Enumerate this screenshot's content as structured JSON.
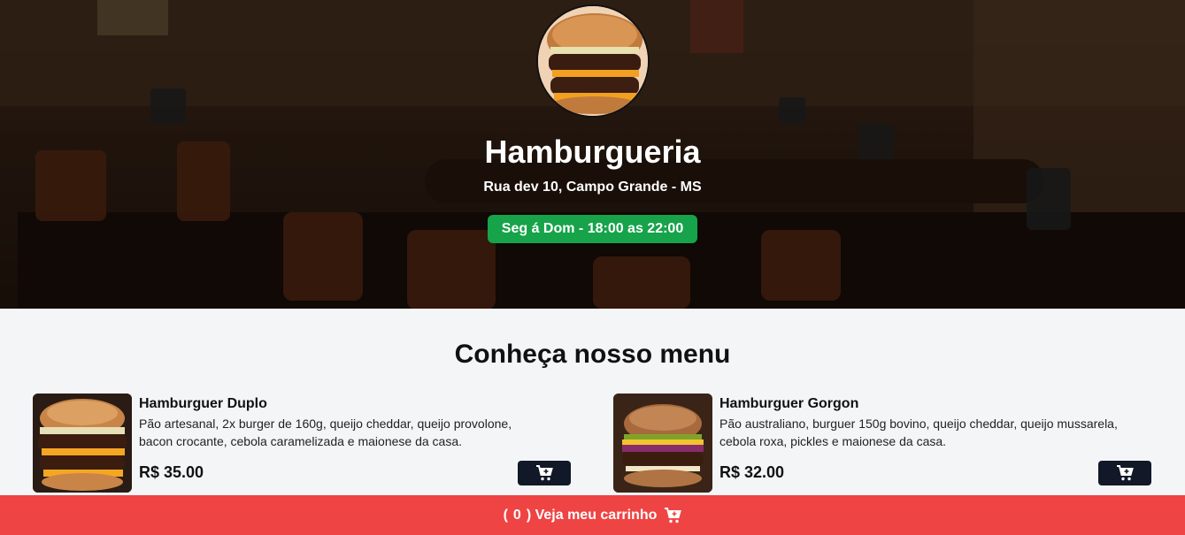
{
  "colors": {
    "hours_badge": "#16a34a",
    "cart_bar": "#ef4444",
    "add_button": "#111827",
    "page_bg": "#f4f5f7"
  },
  "header": {
    "title": "Hamburgueria",
    "address": "Rua dev 10, Campo Grande - MS",
    "hours": "Seg á Dom - 18:00 as 22:00",
    "logo_icon": "burger-logo-image"
  },
  "menu": {
    "title": "Conheça nosso menu",
    "items": [
      {
        "name": "Hamburguer Duplo",
        "description": "Pão artesanal, 2x burger de 160g, queijo cheddar, queijo provolone, bacon crocante, cebola caramelizada e maionese da casa.",
        "price": "R$ 35.00",
        "add_icon": "cart-plus-icon"
      },
      {
        "name": "Hamburguer Gorgon",
        "description": "Pão australiano, burguer 150g bovino, queijo cheddar, queijo mussarela, cebola roxa, pickles e maionese da casa.",
        "price": "R$ 32.00",
        "add_icon": "cart-plus-icon"
      }
    ]
  },
  "cart": {
    "open_paren": "(",
    "count": "0",
    "close_label": ") Veja meu carrinho",
    "icon": "cart-plus-icon"
  }
}
